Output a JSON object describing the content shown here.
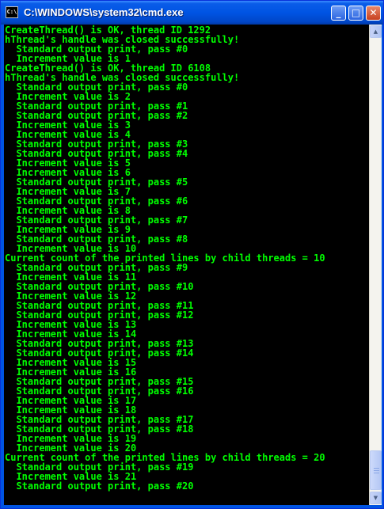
{
  "window": {
    "title": "C:\\WINDOWS\\system32\\cmd.exe",
    "icon": "cmd-icon",
    "icon_text": "C:\\",
    "controls": {
      "minimize": "_",
      "maximize": "□",
      "close": "✕"
    }
  },
  "console": {
    "text_color": "#00ff00",
    "background": "#000000",
    "lines": [
      "CreateThread() is OK, thread ID 1292",
      "hThread's handle was closed successfully!",
      "  Standard output print, pass #0",
      "  Increment value is 1",
      "CreateThread() is OK, thread ID 6108",
      "hThread's handle was closed successfully!",
      "  Standard output print, pass #0",
      "  Increment value is 2",
      "  Standard output print, pass #1",
      "  Standard output print, pass #2",
      "  Increment value is 3",
      "  Increment value is 4",
      "  Standard output print, pass #3",
      "  Standard output print, pass #4",
      "  Increment value is 5",
      "  Increment value is 6",
      "  Standard output print, pass #5",
      "  Increment value is 7",
      "  Standard output print, pass #6",
      "  Increment value is 8",
      "  Standard output print, pass #7",
      "  Increment value is 9",
      "  Standard output print, pass #8",
      "  Increment value is 10",
      "Current count of the printed lines by child threads = 10",
      "  Standard output print, pass #9",
      "  Increment value is 11",
      "  Standard output print, pass #10",
      "  Increment value is 12",
      "  Standard output print, pass #11",
      "  Standard output print, pass #12",
      "  Increment value is 13",
      "  Increment value is 14",
      "  Standard output print, pass #13",
      "  Standard output print, pass #14",
      "  Increment value is 15",
      "  Increment value is 16",
      "  Standard output print, pass #15",
      "  Standard output print, pass #16",
      "  Increment value is 17",
      "  Increment value is 18",
      "  Standard output print, pass #17",
      "  Standard output print, pass #18",
      "  Increment value is 19",
      "  Increment value is 20",
      "Current count of the printed lines by child threads = 20",
      "  Standard output print, pass #19",
      "  Increment value is 21",
      "  Standard output print, pass #20"
    ]
  },
  "scrollbar": {
    "up_arrow": "▲",
    "down_arrow": "▼"
  }
}
